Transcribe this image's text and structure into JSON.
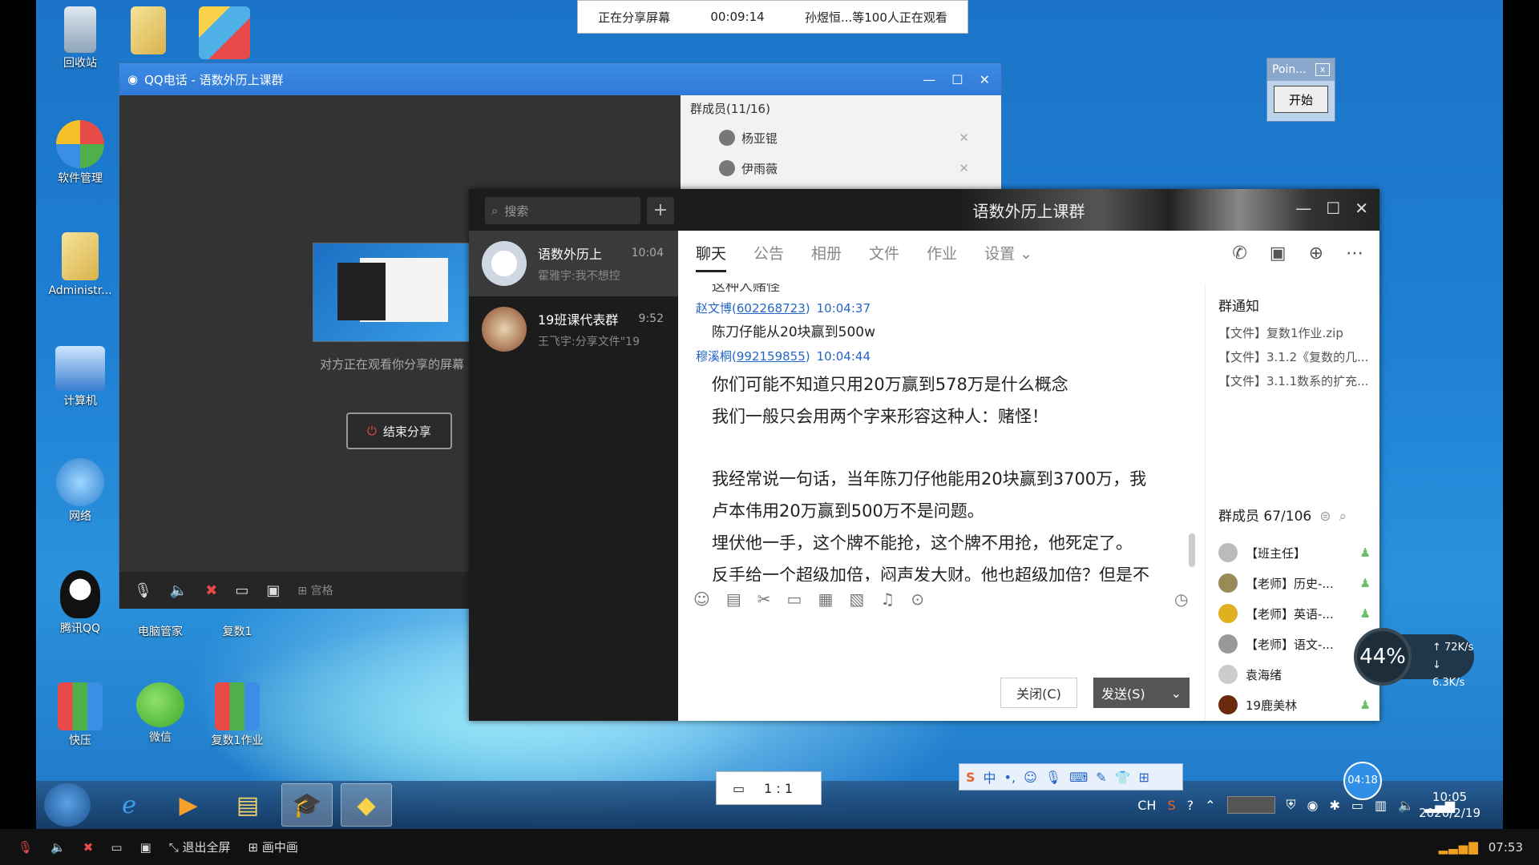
{
  "share_bar": {
    "status": "正在分享屏幕",
    "elapsed": "00:09:14",
    "viewers": "孙煜恒...等100人正在观看"
  },
  "desktop_icons": [
    {
      "label": "回收站",
      "icon": "recycle-bin-icon"
    },
    {
      "label": "软件管理",
      "icon": "software-manager-icon"
    },
    {
      "label": "Administr...",
      "icon": "user-folder-icon"
    },
    {
      "label": "计算机",
      "icon": "computer-icon"
    },
    {
      "label": "网络",
      "icon": "network-icon"
    },
    {
      "label": "腾讯QQ",
      "icon": "qq-penguin-icon"
    },
    {
      "label": "电脑管家",
      "icon": "pc-manager-icon"
    },
    {
      "label": "复数1",
      "icon": "folder-icon"
    },
    {
      "label": "快压",
      "icon": "kuaiya-icon"
    },
    {
      "label": "微信",
      "icon": "wechat-icon"
    },
    {
      "label": "复数1作业",
      "icon": "winrar-icon"
    }
  ],
  "qq_call": {
    "title": "QQ电话 - 语数外历上课群",
    "watching_text": "对方正在观看你分享的屏幕",
    "end_share_label": "结束分享",
    "toolbar_extra": "宫格",
    "members_header": "群成员(11/16)",
    "members": [
      {
        "name": "杨亚锟"
      },
      {
        "name": "伊雨薇"
      }
    ]
  },
  "point_window": {
    "title": "Poin...",
    "close": "x",
    "start_label": "开始"
  },
  "chat": {
    "search_placeholder": "搜索",
    "plus": "+",
    "conversations": [
      {
        "name": "语数外历上",
        "preview": "霍雅宇:我不想控",
        "time": "10:04",
        "color": "#e8eef5"
      },
      {
        "name": "19班课代表群",
        "preview": "王飞宇:分享文件\"19",
        "time": "9:52",
        "color": "#c77a4a"
      }
    ],
    "title": "语数外历上课群",
    "tabs": [
      "聊天",
      "公告",
      "相册",
      "文件",
      "作业",
      "设置 ⌄"
    ],
    "messages": [
      {
        "type": "cut",
        "text": "这种人赌怪"
      },
      {
        "type": "sender",
        "name": "赵文博(",
        "id": "602268723",
        "close": ")",
        "time": "10:04:37"
      },
      {
        "type": "text",
        "text": "陈刀仔能从20块赢到500w"
      },
      {
        "type": "sender",
        "name": "穆溪桐(",
        "id": "992159855",
        "close": ")",
        "time": "10:04:44"
      },
      {
        "type": "big",
        "text": "你们可能不知道只用20万赢到578万是什么概念"
      },
      {
        "type": "big",
        "text": "我们一般只会用两个字来形容这种人：赌怪！"
      },
      {
        "type": "big",
        "text": ""
      },
      {
        "type": "big",
        "text": "我经常说一句话，当年陈刀仔他能用20块赢到3700万，我"
      },
      {
        "type": "big",
        "text": "卢本伟用20万赢到500万不是问题。"
      },
      {
        "type": "big",
        "text": "埋伏他一手，这个牌不能抢，这个牌不用抢，他死定了。"
      },
      {
        "type": "big",
        "text": "反手给一个超级加倍，闷声发大财。他也超级加倍？但是不"
      }
    ],
    "close_label": "关闭(C)",
    "send_label": "发送(S)",
    "notice_title": "群通知",
    "notices": [
      "【文件】复数1作业.zip",
      "【文件】3.1.2《复数的几...",
      "【文件】3.1.1数系的扩充..."
    ],
    "member_title": "群成员 67/106",
    "members": [
      {
        "name": "【班主任】",
        "color": "#bbb"
      },
      {
        "name": "【老师】历史-...",
        "color": "#9a8a5a"
      },
      {
        "name": "【老师】英语-...",
        "color": "#e0b020"
      },
      {
        "name": "【老师】语文-...",
        "color": "#999"
      },
      {
        "name": "袁海绪",
        "color": "#ccc"
      },
      {
        "name": "19鹿美林",
        "color": "#6a2a10"
      }
    ]
  },
  "speed_widget": {
    "percent": "44%",
    "up": "72K/s",
    "down": "6.3K/s"
  },
  "ratio_box": {
    "label": "1 : 1"
  },
  "ime_bar": {
    "brand": "S",
    "mode": "中"
  },
  "timer_badge": "04:18",
  "taskbar": {
    "lang": "CH",
    "time": "10:05",
    "date": "2020/2/19"
  },
  "bottom_bar": {
    "exit_fullscreen": "退出全屏",
    "pip": "画中画",
    "clock": "07:53"
  }
}
